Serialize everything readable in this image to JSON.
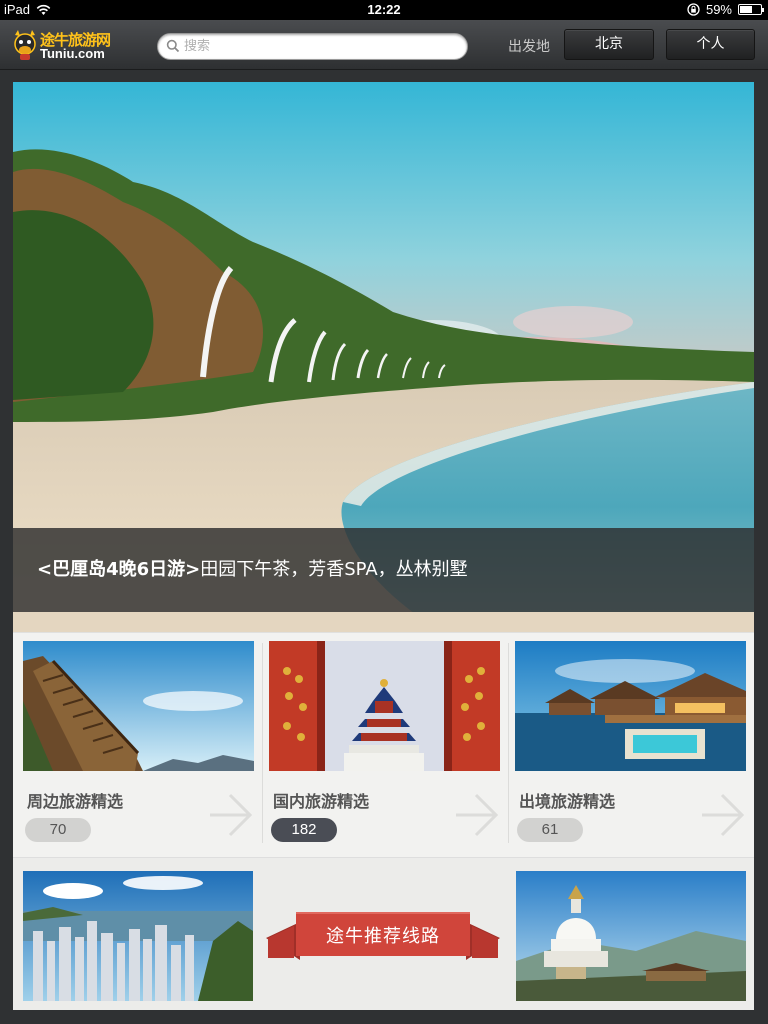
{
  "status_bar": {
    "device": "iPad",
    "time": "12:22",
    "battery": "59%",
    "battery_level": 0.59
  },
  "nav": {
    "logo_cn": "途牛旅游网",
    "logo_en": "Tuniu.com",
    "search_placeholder": "搜索",
    "depart_label": "出发地",
    "city": "北京",
    "personal": "个人"
  },
  "hero": {
    "caption_prefix": "<巴厘岛4晚6日游>",
    "caption_rest": "田园下午茶，芳香SPA，丛林别墅"
  },
  "categories": [
    {
      "title": "周边旅游精选",
      "count": "70",
      "active": false
    },
    {
      "title": "国内旅游精选",
      "count": "182",
      "active": true
    },
    {
      "title": "出境旅游精选",
      "count": "61",
      "active": false
    }
  ],
  "reco": {
    "label": "途牛推荐线路"
  },
  "colors": {
    "accent_red": "#d0453b",
    "logo_yellow": "#ffc21a",
    "active_badge": "#4a4d55"
  }
}
